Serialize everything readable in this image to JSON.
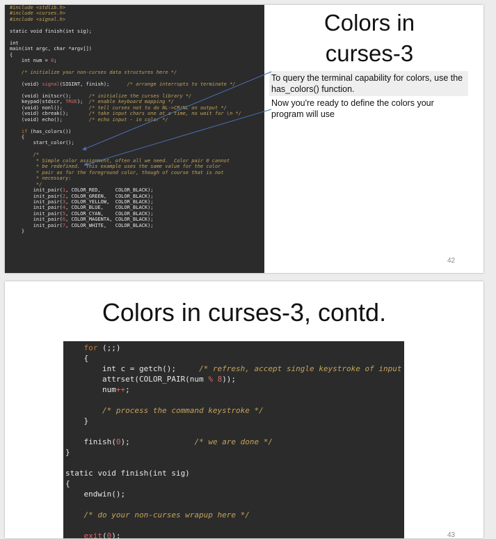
{
  "slide1": {
    "title_line1": "Colors in",
    "title_line2": "curses-3",
    "note1": "To query the terminal capability for colors, use the has_colors() function.",
    "note2": "Now you're ready to define the colors your program will use",
    "page_number": "42",
    "code": {
      "inc1": "#include <stdlib.h>",
      "inc2": "#include <curses.h>",
      "inc3": "#include <signal.h>",
      "finish_decl": "static void finish(int sig);",
      "int_kw": "int",
      "main_sig": "main(int argc, char *argv[])",
      "brace_open": "{",
      "num_decl_a": "    int num = ",
      "num_decl_zero": "0",
      "num_decl_b": ";",
      "init_comment": "    /* initialize your non-curses data structures here */",
      "signal_a": "    (void) ",
      "signal_kw": "signal",
      "signal_b": "(SIGINT, finish);      ",
      "signal_cm": "/* arrange interrupts to terminate */",
      "initscr_a": "    (void) initscr();      ",
      "initscr_cm": "/* initialize the curses library */",
      "keypad_a": "    keypad(stdscr, ",
      "keypad_true": "TRUE",
      "keypad_b": ");  ",
      "keypad_cm": "/* enable keyboard mapping */",
      "nonl_a": "    (void) nonl();         ",
      "nonl_cm": "/* tell curses not to do NL->CR/NL on output */",
      "cbreak_a": "    (void) cbreak();       ",
      "cbreak_cm": "/* take input chars one at a time, no wait for \\n */",
      "echo_a": "    (void) echo();         ",
      "echo_cm": "/* echo input - in color */",
      "if_kw": "    if",
      "if_rest": " (has_colors())",
      "brace_open_inner": "    {",
      "start_color": "        start_color();",
      "cm_block": "        /*\n         * Simple color assignment, often all we need.  Color pair 0 cannot\n         * be redefined.  This example uses the same value for the color\n         * pair as for the foreground color, though of course that is not\n         * necessary:\n         */",
      "pairs": [
        {
          "n": "1",
          "fg": "COLOR_RED,     ",
          "bg": "COLOR_BLACK);"
        },
        {
          "n": "2",
          "fg": "COLOR_GREEN,   ",
          "bg": "COLOR_BLACK);"
        },
        {
          "n": "3",
          "fg": "COLOR_YELLOW,  ",
          "bg": "COLOR_BLACK);"
        },
        {
          "n": "4",
          "fg": "COLOR_BLUE,    ",
          "bg": "COLOR_BLACK);"
        },
        {
          "n": "5",
          "fg": "COLOR_CYAN,    ",
          "bg": "COLOR_BLACK);"
        },
        {
          "n": "6",
          "fg": "COLOR_MAGENTA, ",
          "bg": "COLOR_BLACK);"
        },
        {
          "n": "7",
          "fg": "COLOR_WHITE,   ",
          "bg": "COLOR_BLACK);"
        }
      ],
      "pair_prefix": "        init_pair(",
      "pair_sep": ", ",
      "brace_close_inner": "    }"
    }
  },
  "slide2": {
    "title": "Colors in curses-3, contd.",
    "page_number": "43",
    "code": {
      "for_kw": "    for",
      "for_rest": " (;;)",
      "brace1": "    {",
      "getch_a": "        int c = getch();     ",
      "getch_cm": "/* refresh, accept single keystroke of input */",
      "attrset_a": "        attrset(COLOR_PAIR(num ",
      "attrset_op": "%",
      "attrset_sp": " ",
      "attrset_num": "8",
      "attrset_b": "));",
      "numpp_a": "        num",
      "numpp_op": "++",
      "numpp_b": ";",
      "process_cm": "        /* process the command keystroke */",
      "brace2": "    }",
      "finish_a": "    finish(",
      "finish_zero": "0",
      "finish_b": ");              ",
      "finish_cm": "/* we are done */",
      "brace3": "}",
      "static_line": "static void finish(int sig)",
      "brace4": "{",
      "endwin": "    endwin();",
      "wrapup_cm": "    /* do your non-curses wrapup here */",
      "exit_kw": "    exit",
      "exit_a": "(",
      "exit_zero": "0",
      "exit_b": ");",
      "brace5": "}"
    }
  },
  "colors": {
    "code_bg": "#2b2b2b",
    "keyword": "#cc7832",
    "comment": "#c4a35a",
    "arrow": "#4a6fb5"
  }
}
